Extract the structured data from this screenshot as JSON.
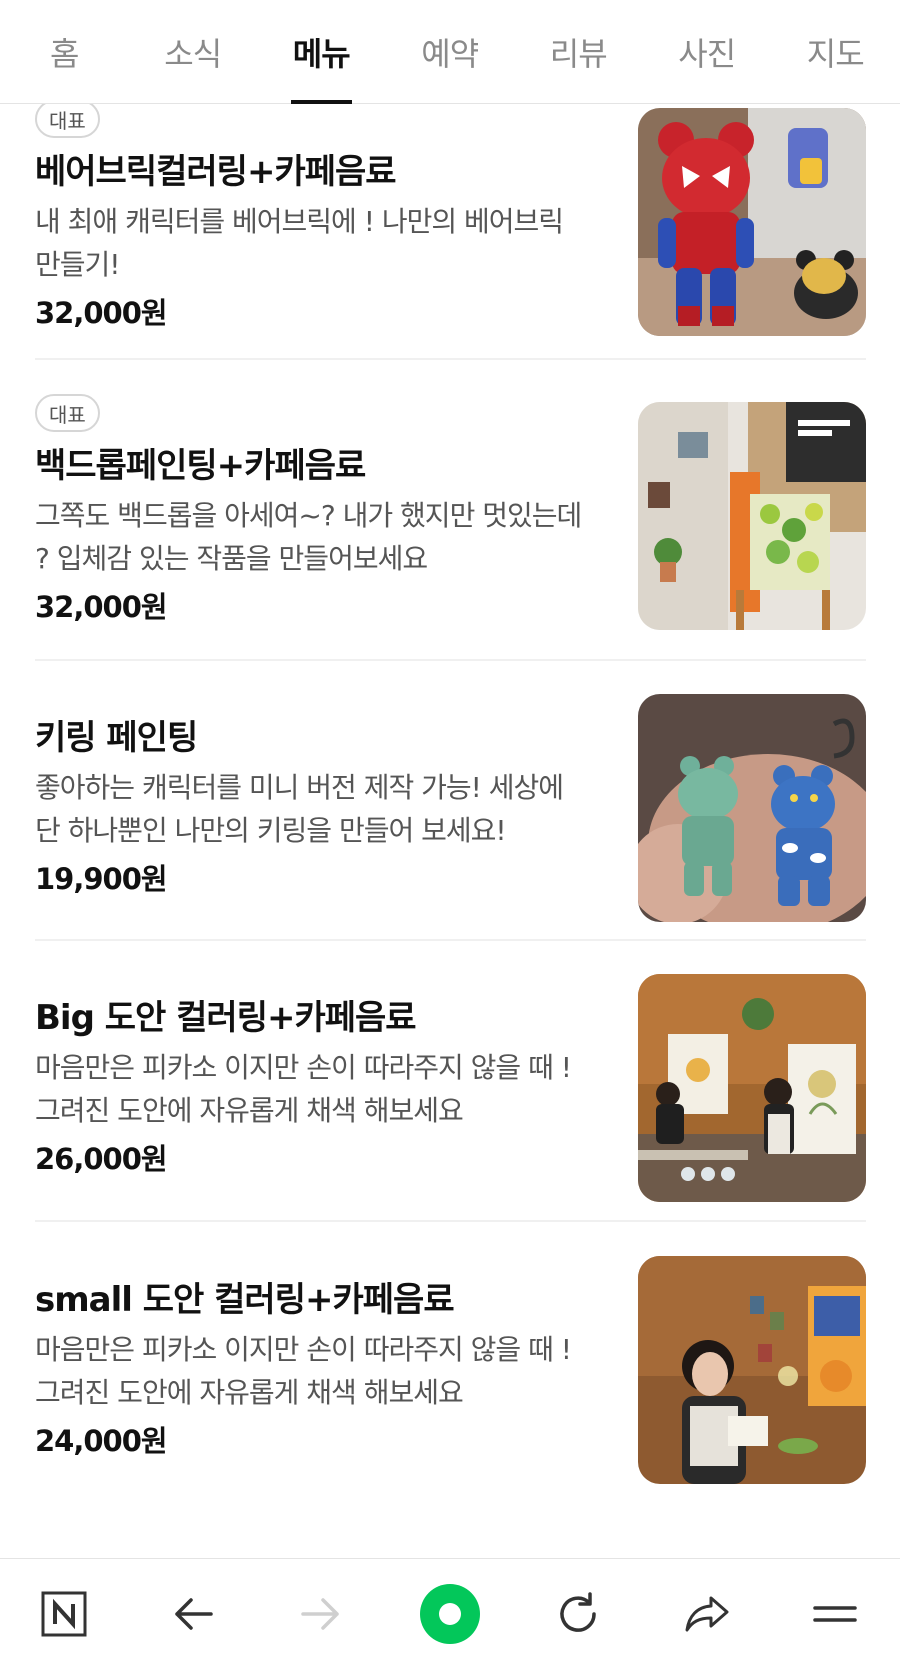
{
  "tabs": [
    {
      "label": "홈",
      "active": false
    },
    {
      "label": "소식",
      "active": false
    },
    {
      "label": "메뉴",
      "active": true
    },
    {
      "label": "예약",
      "active": false
    },
    {
      "label": "리뷰",
      "active": false
    },
    {
      "label": "사진",
      "active": false
    },
    {
      "label": "지도",
      "active": false
    }
  ],
  "menu": [
    {
      "badge": "대표",
      "name": "베어브릭컬러링+카페음료",
      "desc": "내 최애 캐릭터를 베어브릭에 ! 나만의 베어브릭 만들기!",
      "price": "32,000원",
      "image": "spiderman-bearbrick-photo"
    },
    {
      "badge": "대표",
      "name": "백드롭페인팅+카페음료",
      "desc": "그쪽도 백드롭을 아세여~? 내가 했지만 멋있는데 ? 입체감 있는 작품을 만들어보세요",
      "price": "32,000원",
      "image": "backdrop-painting-shop-photo"
    },
    {
      "badge": "",
      "name": "키링 페인팅",
      "desc": "좋아하는 캐릭터를 미니 버전 제작 가능! 세상에 단 하나뿐인 나만의 키링을 만들어 보세요!",
      "price": "19,900원",
      "image": "keyring-bears-photo"
    },
    {
      "badge": "",
      "name": "Big 도안 컬러링+카페음료",
      "desc": "마음만은 피카소 이지만 손이 따라주지 않을 때 ! 그려진 도안에 자유롭게 채색 해보세요",
      "price": "26,000원",
      "image": "easel-coloring-photo"
    },
    {
      "badge": "",
      "name": "small 도안 컬러링+카페음료",
      "desc": "마음만은 피카소 이지만 손이 따라주지 않을 때 ! 그려진 도안에 자유롭게 채색 해보세요",
      "price": "24,000원",
      "image": "small-coloring-photo"
    }
  ],
  "bottom_bar": [
    {
      "icon": "naver-n-icon"
    },
    {
      "icon": "back-arrow-icon"
    },
    {
      "icon": "forward-arrow-icon"
    },
    {
      "icon": "green-dot-home-icon"
    },
    {
      "icon": "refresh-icon"
    },
    {
      "icon": "share-icon"
    },
    {
      "icon": "menu-icon"
    }
  ],
  "colors": {
    "accent_green": "#03c75a",
    "text_primary": "#111111",
    "text_secondary": "#555555",
    "tab_inactive": "#8a8a8a"
  }
}
